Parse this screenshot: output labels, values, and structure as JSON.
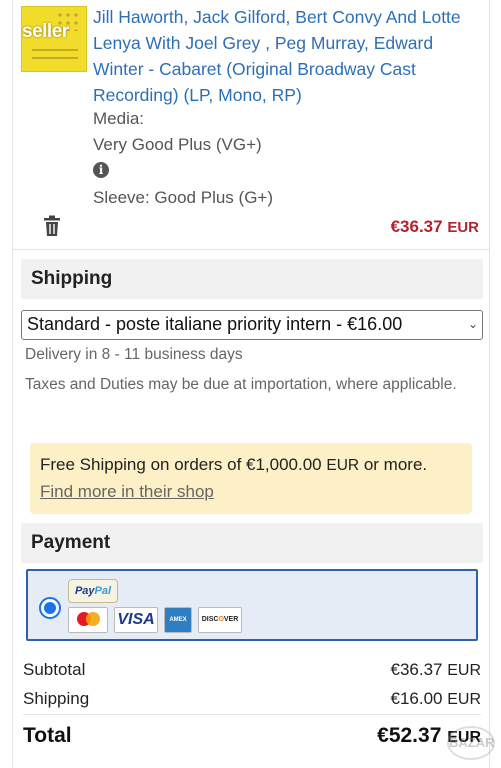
{
  "cart_item": {
    "thumbnail_badge": "seller",
    "title": "Jill Haworth, Jack Gilford, Bert Convy And Lotte Lenya With Joel Grey , Peg Murray, Edward Winter - Cabaret (Original Broadway Cast Recording) (LP, Mono, RP)",
    "media_label": "Media:",
    "media_value": "Very Good Plus (VG+)",
    "sleeve": "Sleeve: Good Plus (G+)",
    "price": "€36.37",
    "price_currency": "EUR",
    "info_icon": "info-icon",
    "remove_icon": "trash-icon"
  },
  "shipping": {
    "heading": "Shipping",
    "selected_option": "Standard - poste italiane priority intern - €16.00",
    "delivery": "Delivery in 8 - 11 business days",
    "taxes_note": "Taxes and Duties may be due at importation, where applicable.",
    "free_shipping_text": "Free Shipping on orders of €1,000.00",
    "free_shipping_currency": "EUR",
    "free_shipping_suffix": "or more.",
    "find_more_link": "Find more in their shop"
  },
  "payment": {
    "heading": "Payment",
    "paypal_label": "PayPal",
    "cards": [
      "MasterCard",
      "VISA",
      "AMERICAN EXPRESS",
      "DISCOVER"
    ]
  },
  "summary": {
    "subtotal_label": "Subtotal",
    "subtotal_value": "€36.37",
    "shipping_label": "Shipping",
    "shipping_value": "€16.00",
    "currency": "EUR",
    "total_label": "Total",
    "total_value": "€52.37"
  },
  "colors": {
    "link": "#2d6fb7",
    "price": "#b3232f",
    "notice_bg": "#fdf0c6",
    "payment_border": "#2e62a8"
  }
}
